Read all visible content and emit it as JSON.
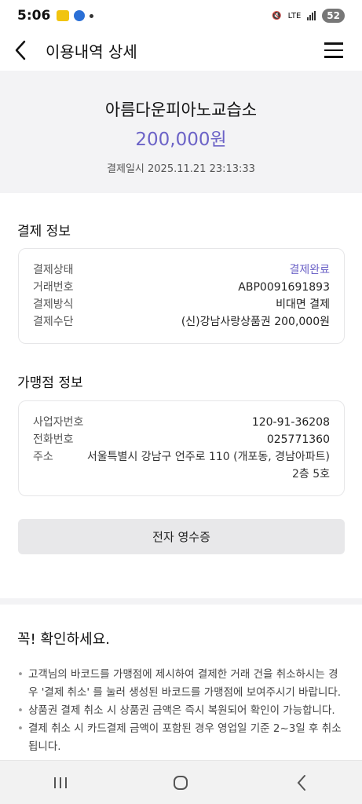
{
  "status_bar": {
    "time": "5:06",
    "net_label": "LTE",
    "battery": "52"
  },
  "header": {
    "title": "이용내역 상세"
  },
  "hero": {
    "merchant": "아름다운피아노교습소",
    "amount": "200,000원",
    "paid_at": "결제일시 2025.11.21 23:13:33"
  },
  "payment_info": {
    "title": "결제 정보",
    "rows": [
      {
        "label": "결제상태",
        "value": "결제완료"
      },
      {
        "label": "거래번호",
        "value": "ABP0091691893"
      },
      {
        "label": "결제방식",
        "value": "비대면 결제"
      },
      {
        "label": "결제수단",
        "value": "(신)강남사랑상품권 200,000원"
      }
    ]
  },
  "merchant_info": {
    "title": "가맹점 정보",
    "rows": [
      {
        "label": "사업자번호",
        "value": "120-91-36208"
      },
      {
        "label": "전화번호",
        "value": "025771360"
      },
      {
        "label": "주소",
        "value_line1": "서울특별시 강남구 언주로 110 (개포동, 경남아파트)",
        "value_line2": "2층 5호"
      }
    ]
  },
  "receipt_button": "전자 영수증",
  "notice": {
    "title": "꼭! 확인하세요.",
    "items": [
      "고객님의 바코드를 가맹점에 제시하여 결제한 거래 건을 취소하시는 경우 '결제 취소' 를 눌러 생성된 바코드를 가맹점에 보여주시기 바랍니다.",
      "상품권 결제 취소 시 상품권 금액은 즉시 복원되어 확인이 가능합니다.",
      "결제 취소 시 카드결제 금액이 포함된 경우 영업일 기준 2~3일 후 취소됩니다."
    ]
  },
  "colors": {
    "accent": "#6c63c7",
    "hero_bg": "#f3f3f5"
  }
}
